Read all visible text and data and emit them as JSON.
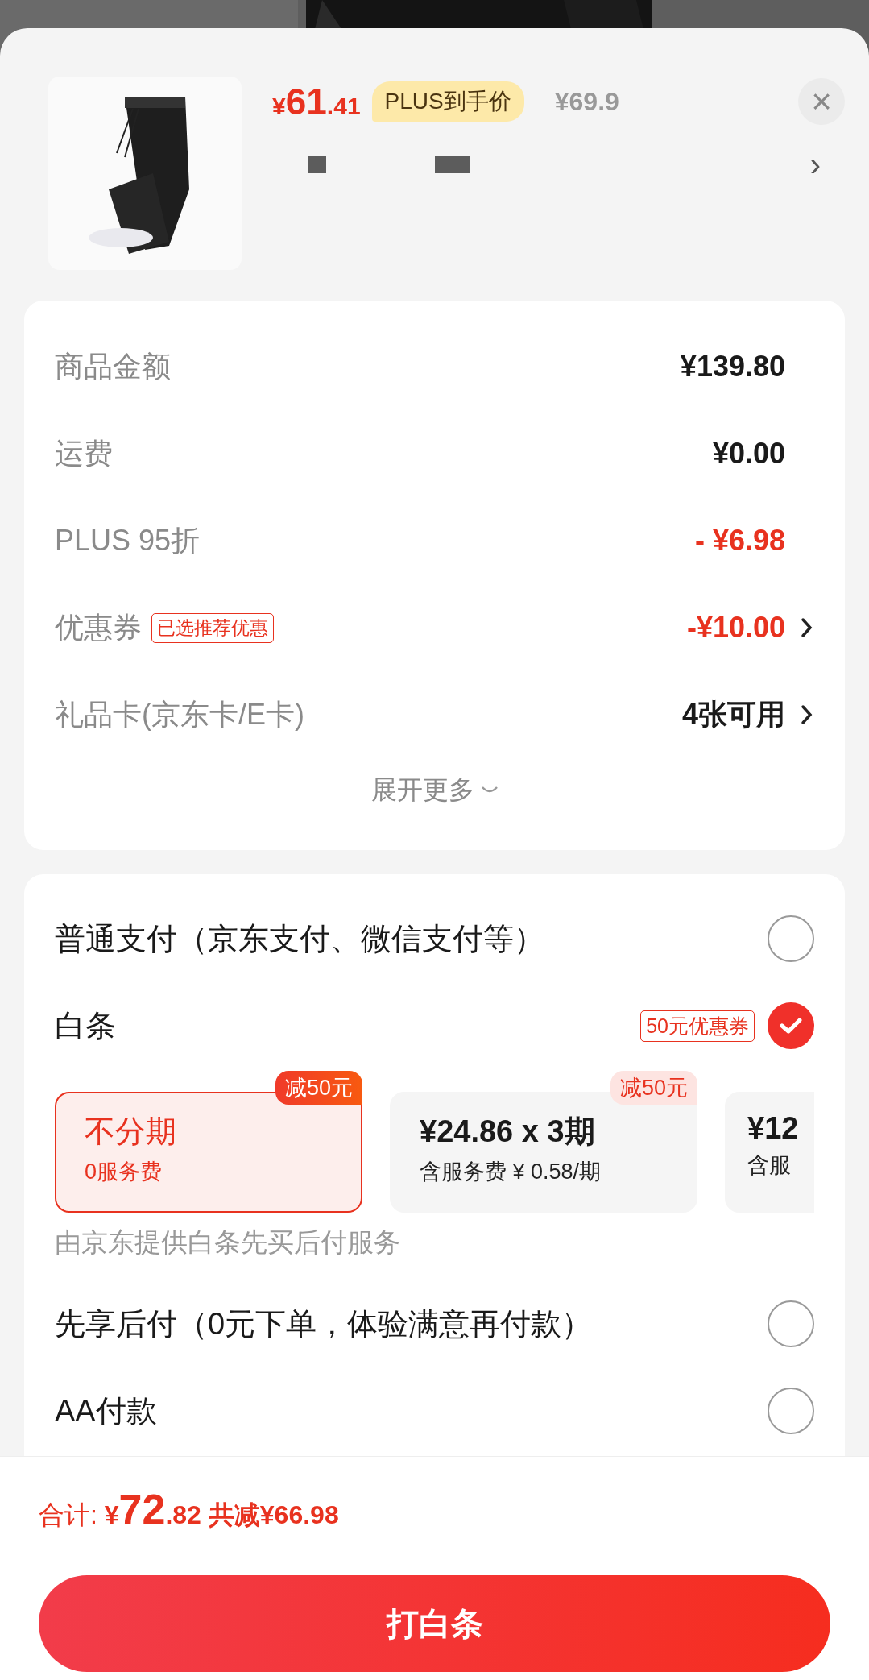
{
  "product": {
    "price_symbol": "¥",
    "price_int": "61",
    "price_dec": ".41",
    "price_badge": "PLUS到手价",
    "original_price": "¥69.9",
    "close": "×",
    "spec_arrow": "›"
  },
  "fees": [
    {
      "label": "商品金额",
      "value": "¥139.80",
      "kind": "plain",
      "arrow": false
    },
    {
      "label": "运费",
      "value": "¥0.00",
      "kind": "plain",
      "arrow": false
    },
    {
      "label": "PLUS 95折",
      "value": "- ¥6.98",
      "kind": "discount",
      "arrow": false
    },
    {
      "label": "优惠券",
      "tag": "已选推荐优惠",
      "value": "-¥10.00",
      "kind": "discount",
      "arrow": true
    },
    {
      "label": "礼品卡(京东卡/E卡)",
      "value": "4张可用",
      "kind": "plain",
      "arrow": true
    }
  ],
  "expand_more": "展开更多",
  "payment_methods": [
    {
      "label": "普通支付（京东支付、微信支付等）",
      "selected": false
    },
    {
      "label": "白条",
      "badge": "50元优惠券",
      "selected": true,
      "installments": [
        {
          "title": "不分期",
          "subtitle": "0服务费",
          "badge": "减50元",
          "selected": true
        },
        {
          "title": "¥24.86 x 3期",
          "subtitle": "含服务费 ¥ 0.58/期",
          "badge": "减50元",
          "selected": false
        },
        {
          "title": "¥12",
          "subtitle": "含服",
          "selected": false
        }
      ],
      "note": "由京东提供白条先买后付服务"
    },
    {
      "label": "先享后付（0元下单，体验满意再付款）",
      "selected": false
    },
    {
      "label": "AA付款",
      "selected": false
    }
  ],
  "total": {
    "label": "合计:",
    "symbol": "¥",
    "int": "72",
    "dec": ".82",
    "saved": "共减¥66.98"
  },
  "submit_button": "打白条"
}
